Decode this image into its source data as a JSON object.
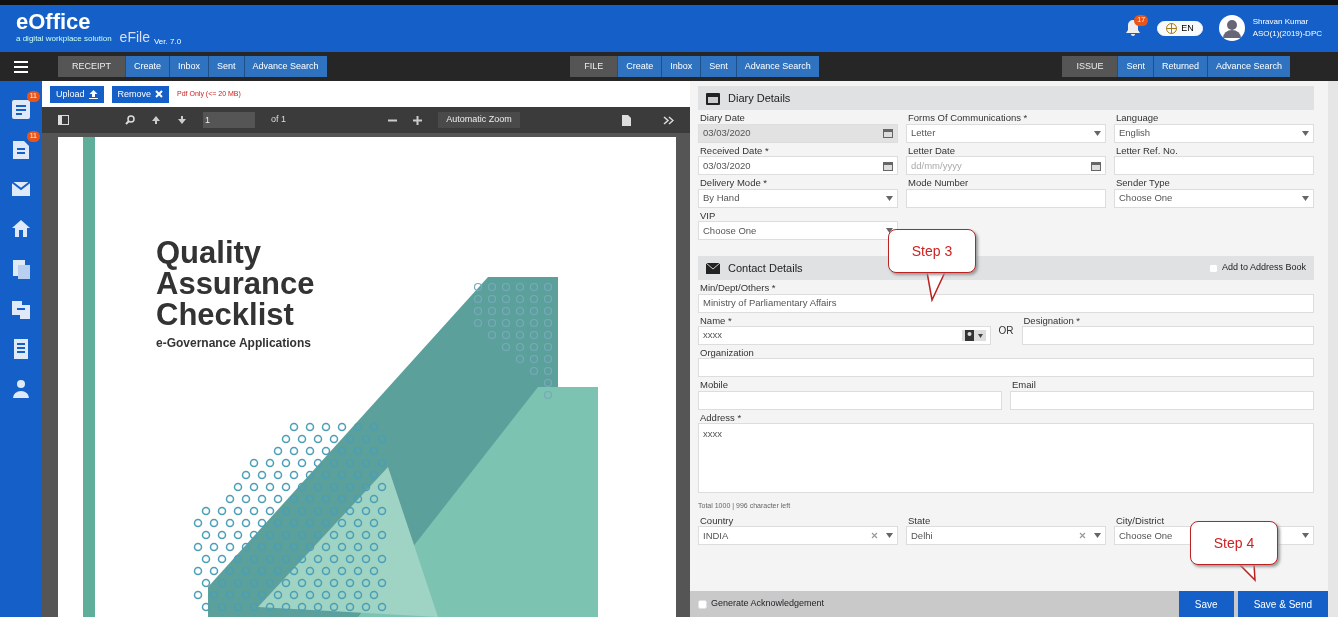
{
  "header": {
    "logo": "eOffice",
    "tagline": "a digital workplace solution",
    "app": "eFile",
    "version": "Ver. 7.0",
    "notification_count": "17",
    "language": "EN",
    "user_name": "Shravan Kumar",
    "user_id": "ASO(1)(2019)-DPC"
  },
  "nav_groups": [
    {
      "label": "RECEIPT",
      "items": [
        "Create",
        "Inbox",
        "Sent",
        "Advance Search"
      ]
    },
    {
      "label": "FILE",
      "items": [
        "Create",
        "Inbox",
        "Sent",
        "Advance Search"
      ]
    },
    {
      "label": "ISSUE",
      "items": [
        "Sent",
        "Returned",
        "Advance Search"
      ]
    }
  ],
  "sidebar": [
    {
      "kind": "receipt",
      "badge": "11"
    },
    {
      "kind": "file",
      "badge": "11"
    },
    {
      "kind": "mail"
    },
    {
      "kind": "home"
    },
    {
      "kind": "docs"
    },
    {
      "kind": "transfer"
    },
    {
      "kind": "list"
    },
    {
      "kind": "user"
    }
  ],
  "upload_bar": {
    "upload": "Upload",
    "remove": "Remove",
    "note": "Pdf Only (<= 20 MB)"
  },
  "pdf_toolbar": {
    "page": "1",
    "page_count": "of 1",
    "zoom": "Automatic Zoom"
  },
  "document": {
    "title_lines": [
      "Quality",
      "Assurance",
      "Checklist"
    ],
    "subtitle": "e-Governance Applications"
  },
  "diary": {
    "title": "Diary Details",
    "rows": [
      [
        {
          "kind": "date",
          "label": "Diary Date",
          "value": "03/03/2020",
          "disabled": true
        },
        {
          "kind": "select",
          "label": "Forms Of Communications *",
          "value": "Letter"
        },
        {
          "kind": "select",
          "label": "Language",
          "value": "English"
        }
      ],
      [
        {
          "kind": "date",
          "label": "Received Date *",
          "value": "03/03/2020"
        },
        {
          "kind": "date",
          "label": "Letter Date",
          "placeholder": "dd/mm/yyyy"
        },
        {
          "kind": "text",
          "label": "Letter Ref. No."
        }
      ],
      [
        {
          "kind": "select",
          "label": "Delivery Mode *",
          "value": "By Hand"
        },
        {
          "kind": "text",
          "label": "Mode Number"
        },
        {
          "kind": "select",
          "label": "Sender Type",
          "value": "Choose One"
        }
      ],
      [
        {
          "kind": "select",
          "label": "VIP",
          "value": "Choose One"
        },
        {
          "kind": "blank"
        },
        {
          "kind": "blank"
        }
      ]
    ]
  },
  "contact": {
    "title": "Contact Details",
    "callout": "Step 3",
    "address_book": {
      "label": "Add to Address Book",
      "checked": false
    },
    "rows": [
      [
        {
          "kind": "text",
          "label": "Min/Dept/Others *",
          "value": "Ministry of Parliamentary Affairs"
        }
      ],
      [
        {
          "kind": "picker",
          "label": "Name *",
          "value": "xxxx"
        },
        {
          "kind": "separator",
          "text": "OR"
        },
        {
          "kind": "text",
          "label": "Designation *"
        }
      ],
      [
        {
          "kind": "text",
          "label": "Organization"
        }
      ],
      [
        {
          "kind": "text",
          "label": "Mobile"
        },
        {
          "kind": "text",
          "label": "Email"
        }
      ],
      [
        {
          "kind": "area",
          "label": "Address *",
          "value": "xxxx"
        }
      ],
      [
        {
          "kind": "note",
          "text": "Total 1000 | 996 character left"
        }
      ],
      [
        {
          "kind": "select",
          "label": "Country",
          "value": "INDIA",
          "clearable": true
        },
        {
          "kind": "select",
          "label": "State",
          "value": "Delhi",
          "clearable": true
        },
        {
          "kind": "select",
          "label": "City/District",
          "value": "Choose One"
        }
      ]
    ]
  },
  "footer": {
    "callout": "Step 4",
    "acknowledgement": {
      "label": "Generate Acknowledgement",
      "checked": false
    },
    "buttons": [
      "Save",
      "Save & Send"
    ]
  }
}
